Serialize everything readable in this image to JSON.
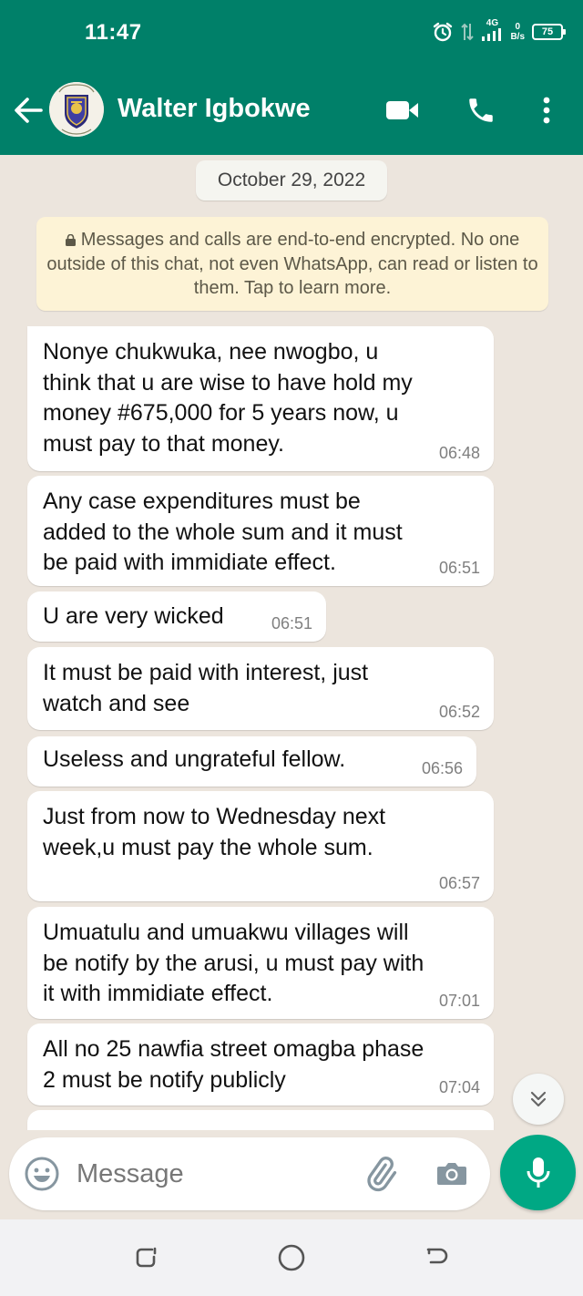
{
  "status_bar": {
    "time": "11:47",
    "network": "4G",
    "speed_value": "0",
    "speed_unit": "B/s",
    "battery": "75"
  },
  "header": {
    "contact_name": "Walter Igbokwe",
    "icons": [
      "back-arrow-icon",
      "video-call-icon",
      "voice-call-icon",
      "more-options-icon"
    ]
  },
  "chat": {
    "date_chip": "October 29, 2022",
    "encryption_notice": "Messages and calls are end-to-end encrypted. No one outside of this chat, not even WhatsApp, can read or listen to them. Tap to learn more.",
    "messages": [
      {
        "text": "Nonye chukwuka, nee nwogbo, u\nthink that u are wise to have hold my\nmoney #675,000 for 5 years now, u\nmust pay to that money.",
        "time": "06:48"
      },
      {
        "text": "Any case expenditures must be\nadded to the whole sum and it must\nbe paid with immidiate effect.",
        "time": "06:51"
      },
      {
        "text": "U are very wicked",
        "time": "06:51"
      },
      {
        "text": "It must be paid with interest, just\nwatch and see",
        "time": "06:52"
      },
      {
        "text": "Useless and ungrateful fellow.",
        "time": "06:56"
      },
      {
        "text": "Just from now to Wednesday next\nweek,u must pay the whole sum.",
        "time": "06:57"
      },
      {
        "text": "Umuatulu and umuakwu villages will\nbe notify by the arusi, u must pay with\nit with  immidiate effect.",
        "time": "07:01"
      },
      {
        "text": "All no 25 nawfia street omagba phase\n2 must be notify publicly",
        "time": "07:04"
      }
    ]
  },
  "composer": {
    "placeholder": "Message"
  },
  "colors": {
    "header": "#008069",
    "accent": "#00a884",
    "chat_background": "#ece5dd",
    "encryption_notice_bg": "#fdf3d6"
  }
}
